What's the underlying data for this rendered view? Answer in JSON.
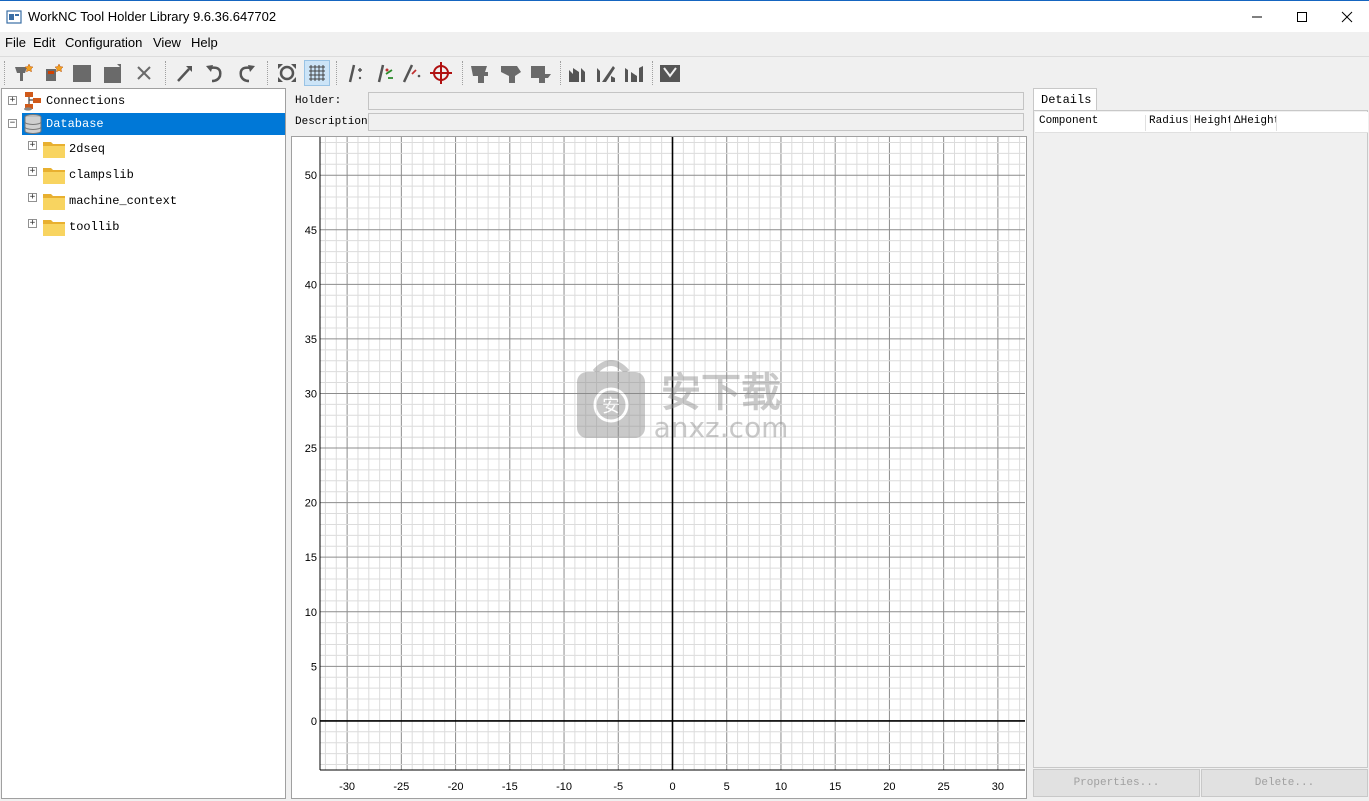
{
  "window": {
    "title": "WorkNC Tool Holder Library 9.6.36.647702"
  },
  "menu": [
    "File",
    "Edit",
    "Configuration",
    "View",
    "Help"
  ],
  "toolbar": {
    "icons": [
      "new-holder-icon",
      "new-component-icon",
      "save-icon",
      "save-as-icon",
      "delete-icon",
      "pick-icon",
      "undo-icon",
      "redo-icon",
      "zoom-fit-icon",
      "grid-icon",
      "add-point-icon",
      "move-point-icon",
      "delete-point-icon",
      "center-icon",
      "holder-shape-1-icon",
      "holder-shape-2-icon",
      "holder-shape-3-icon",
      "profile-1-icon",
      "profile-2-icon",
      "profile-3-icon",
      "profile-4-icon"
    ]
  },
  "tree": {
    "items": [
      {
        "label": "Connections",
        "expander": "+"
      },
      {
        "label": "Database",
        "expander": "−",
        "selected": true
      },
      {
        "label": "2dseq",
        "expander": "+"
      },
      {
        "label": "clampslib",
        "expander": "+"
      },
      {
        "label": "machine_context",
        "expander": "+"
      },
      {
        "label": "toollib",
        "expander": "+"
      }
    ]
  },
  "form": {
    "holder_label": "Holder:",
    "holder_value": "",
    "description_label": "Description:",
    "description_value": ""
  },
  "chart_data": {
    "type": "scatter",
    "x_ticks": [
      -30,
      -25,
      -20,
      -15,
      -10,
      -5,
      0,
      5,
      10,
      15,
      20,
      25,
      30
    ],
    "y_ticks": [
      0,
      5,
      10,
      15,
      20,
      25,
      30,
      35,
      40,
      45,
      50
    ],
    "xlim": [
      -32.5,
      32.5
    ],
    "ylim": [
      -4.5,
      53.5
    ],
    "minor_grid": 1,
    "major_grid": 5,
    "grid": true,
    "series": []
  },
  "details": {
    "tab_label": "Details",
    "columns": [
      "Component",
      "Radius",
      "Height",
      "ΔHeight"
    ],
    "rows": [],
    "properties_button": "Properties...",
    "delete_button": "Delete..."
  },
  "watermark": {
    "text_cn": "安下载",
    "text_en": "anxz.com"
  }
}
